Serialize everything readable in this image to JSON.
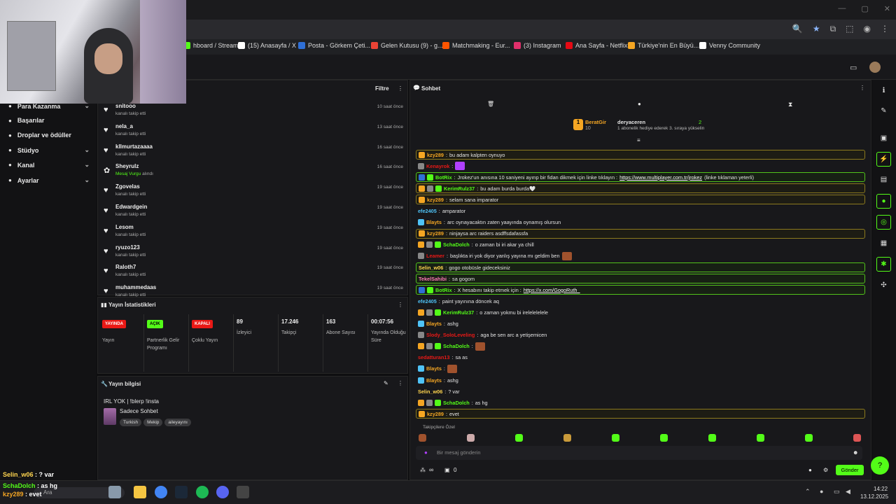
{
  "window": {
    "controls": [
      "—",
      "▢",
      "✕"
    ]
  },
  "bookmarks": [
    {
      "label": "hboard / Stream...",
      "icon": "dashboard-icon",
      "color": "#53fc18"
    },
    {
      "label": "(15) Anasayfa / X",
      "icon": "x-icon",
      "color": "#ffffff"
    },
    {
      "label": "Posta - Görkem Çeti...",
      "icon": "outlook-icon",
      "color": "#2f6fd6"
    },
    {
      "label": "Gelen Kutusu (9) - g...",
      "icon": "gmail-icon",
      "color": "#ea4335"
    },
    {
      "label": "Matchmaking - Eur...",
      "icon": "faceit-icon",
      "color": "#ff5500"
    },
    {
      "label": "(3) Instagram",
      "icon": "instagram-icon",
      "color": "#e1306c"
    },
    {
      "label": "Ana Sayfa - Netflix",
      "icon": "netflix-icon",
      "color": "#e50914"
    },
    {
      "label": "Türkiye'nin En Büyü...",
      "icon": "shop-icon",
      "color": "#f5a623"
    },
    {
      "label": "Venny Community",
      "icon": "venny-icon",
      "color": "#ffffff"
    }
  ],
  "sidebar": {
    "items": [
      {
        "label": "Para Kazanma",
        "icon": "money-icon",
        "chevron": true
      },
      {
        "label": "Başarılar",
        "icon": "trophy-icon",
        "chevron": false
      },
      {
        "label": "Droplar ve ödüller",
        "icon": "gift-icon",
        "chevron": false
      },
      {
        "label": "Stüdyo",
        "icon": "studio-icon",
        "chevron": true
      },
      {
        "label": "Kanal",
        "icon": "channel-icon",
        "chevron": true
      },
      {
        "label": "Ayarlar",
        "icon": "settings-icon",
        "chevron": true
      }
    ]
  },
  "followers": {
    "filter_label": "Filtre",
    "rows": [
      {
        "name": "snitooo",
        "action": "kanalı takip etti",
        "time": "10 saat önce"
      },
      {
        "name": "nela_a",
        "action": "kanalı takip etti",
        "time": "13 saat önce"
      },
      {
        "name": "kllmurtazaaaa",
        "action": "kanalı takip etti",
        "time": "16 saat önce"
      },
      {
        "name": "Sheyrulz",
        "action_highlight": "Mesaj Vurgu",
        "action": "alındı",
        "time": "16 saat önce"
      },
      {
        "name": "Zgovelas",
        "action": "kanalı takip etti",
        "time": "19 saat önce"
      },
      {
        "name": "Edwardgein",
        "action": "kanalı takip etti",
        "time": "19 saat önce"
      },
      {
        "name": "Lesom",
        "action": "kanalı takip etti",
        "time": "19 saat önce"
      },
      {
        "name": "ryuzo123",
        "action": "kanalı takip etti",
        "time": "19 saat önce"
      },
      {
        "name": "Raloth7",
        "action": "kanalı takip etti",
        "time": "19 saat önce"
      },
      {
        "name": "muhammedaas",
        "action": "kanalı takip etti",
        "time": "19 saat önce"
      }
    ]
  },
  "stats": {
    "title": "Yayın İstatistikleri",
    "cols": [
      {
        "badge": "YAYINDA",
        "badge_color": "#e91916",
        "label": "Yayın"
      },
      {
        "badge": "AÇIK",
        "badge_color": "#53fc18",
        "label": "Partnerlik Gelir Programı"
      },
      {
        "badge": "KAPALI",
        "badge_color": "#e91916",
        "label": "Çoklu Yayın"
      },
      {
        "value": "89",
        "label": "İzleyici"
      },
      {
        "value": "17.246",
        "label": "Takipçi"
      },
      {
        "value": "163",
        "label": "Abone Sayısı"
      },
      {
        "value": "00:07:56",
        "label": "Yayında Olduğu Süre"
      }
    ]
  },
  "stream_info": {
    "title": "Yayın bilgisi",
    "stream_title": "IRL YOK | !blerp !insta",
    "category": "Sadece Sohbet",
    "tags": [
      "Turkish",
      "Mekip",
      "aileyayını"
    ]
  },
  "chat": {
    "title": "Sohbet",
    "pinned_user1": "BeratGir",
    "pinned_user1_level": "10",
    "pinned_user2": "deryaceren",
    "pinned_count": "2",
    "pinned_text": "1 abonelik hediye ederek 3. sıraya yükselin",
    "messages": [
      {
        "user": "kzy289",
        "color": "#f5a623",
        "text": "bu adam kalpten oynuyo",
        "style": "hl",
        "icons": [
          "#f5a623"
        ]
      },
      {
        "user": "Kenayrok",
        "color": "#e91916",
        "text": "",
        "style": "",
        "icons": [
          "#888"
        ],
        "emote": "#b040ff"
      },
      {
        "user": "BotRix",
        "color": "#53fc18",
        "text": "Jrokez'un anısına 10 saniyeni ayırıp bir fidan dikmek için linke tıklayın : ",
        "link": "https://www.multiplayer.com.tr/jrokez",
        "after": " (linke tıklaman yeterli)",
        "style": "hlg",
        "icons": [
          "#2f6fd6",
          "#53fc18"
        ]
      },
      {
        "user": "KerimRulz37",
        "color": "#53fc18",
        "text": "bu adam burda burda🤍",
        "style": "hl",
        "icons": [
          "#f5a623",
          "#888",
          "#53fc18"
        ]
      },
      {
        "user": "kzy289",
        "color": "#f5a623",
        "text": "selam sana imparator",
        "style": "hl",
        "icons": [
          "#f5a623"
        ]
      },
      {
        "user": "efe2405",
        "color": "#4fc3f7",
        "text": "amparator",
        "style": "",
        "icons": []
      },
      {
        "user": "Blayts",
        "color": "#f5a623",
        "text": "arc oynayacaktın zaten yaayında oynamış olursun",
        "style": "",
        "icons": [
          "#4fc3f7"
        ]
      },
      {
        "user": "kzy289",
        "color": "#f5a623",
        "text": "ninjaysa arc raiders asdffsdafassfa",
        "style": "hl",
        "icons": [
          "#f5a623"
        ]
      },
      {
        "user": "SchaDolch",
        "color": "#53fc18",
        "text": "o zaman bi iri akar ya chill",
        "style": "",
        "icons": [
          "#f5a623",
          "#888",
          "#53fc18"
        ]
      },
      {
        "user": "Leamer",
        "color": "#e91916",
        "text": "başlıkta iri yok diyor yanlış yayına mı geldim ben",
        "style": "",
        "icons": [
          "#888"
        ],
        "emote": "#a0522d"
      },
      {
        "user": "Selin_w06",
        "color": "#ffd54f",
        "text": "gogo otobüsle gideceksiniz",
        "style": "hlg",
        "icons": []
      },
      {
        "user": "TekelSahibi",
        "color": "#ff7ab6",
        "text": "sa gogom",
        "style": "hlg",
        "icons": []
      },
      {
        "user": "BotRix",
        "color": "#53fc18",
        "text": "X hesabını takip etmek için : ",
        "link": "https://x.com/GogoRuth_",
        "after": "",
        "style": "hlg",
        "icons": [
          "#2f6fd6",
          "#53fc18"
        ]
      },
      {
        "user": "efe2405",
        "color": "#4fc3f7",
        "text": "paint yayınına döncek aq",
        "style": "",
        "icons": []
      },
      {
        "user": "KerimRulz37",
        "color": "#53fc18",
        "text": "o zaman yokmu bi irelelelelele",
        "style": "",
        "icons": [
          "#f5a623",
          "#888",
          "#53fc18"
        ]
      },
      {
        "user": "Blayts",
        "color": "#f5a623",
        "text": "ashg",
        "style": "",
        "icons": [
          "#4fc3f7"
        ]
      },
      {
        "user": "Slody_SoloLeveling",
        "color": "#e91916",
        "text": "aga be sen arc a yetişemicen",
        "style": "",
        "icons": [
          "#888"
        ]
      },
      {
        "user": "SchaDolch",
        "color": "#53fc18",
        "text": "",
        "style": "",
        "icons": [
          "#f5a623",
          "#888",
          "#53fc18"
        ],
        "emote": "#a0522d"
      },
      {
        "user": "sedatturan13",
        "color": "#e91916",
        "text": "sa as",
        "style": "",
        "icons": []
      },
      {
        "user": "Blayts",
        "color": "#f5a623",
        "text": "",
        "style": "",
        "icons": [
          "#4fc3f7"
        ],
        "emote": "#a0522d"
      },
      {
        "user": "Blayts",
        "color": "#f5a623",
        "text": "ashg",
        "style": "",
        "icons": [
          "#4fc3f7"
        ]
      },
      {
        "user": "Selin_w06",
        "color": "#ffd54f",
        "text": "? var",
        "style": "",
        "icons": []
      },
      {
        "user": "SchaDolch",
        "color": "#53fc18",
        "text": "as hg",
        "style": "",
        "icons": [
          "#f5a623",
          "#888",
          "#53fc18"
        ]
      },
      {
        "user": "kzy289",
        "color": "#f5a623",
        "text": "evet",
        "style": "hl",
        "icons": [
          "#f5a623"
        ]
      }
    ],
    "followers_only": "Takipçilere Özel",
    "input_placeholder": "Bir mesaj gönderin",
    "send_label": "Gönder",
    "infinity_label": "∞",
    "count_label": "0"
  },
  "overlay": {
    "lines": [
      {
        "user": "Selin_w06",
        "text": ": ? var",
        "color": "#ffd54f"
      },
      {
        "user": "SchaDolch",
        "text": ": as hg",
        "color": "#53fc18"
      },
      {
        "user": "kzy289",
        "text": ": evet",
        "color": "#f5a623"
      }
    ]
  },
  "taskbar": {
    "search_label": "Ara",
    "time": "14:22",
    "date": "13.12.2025"
  }
}
